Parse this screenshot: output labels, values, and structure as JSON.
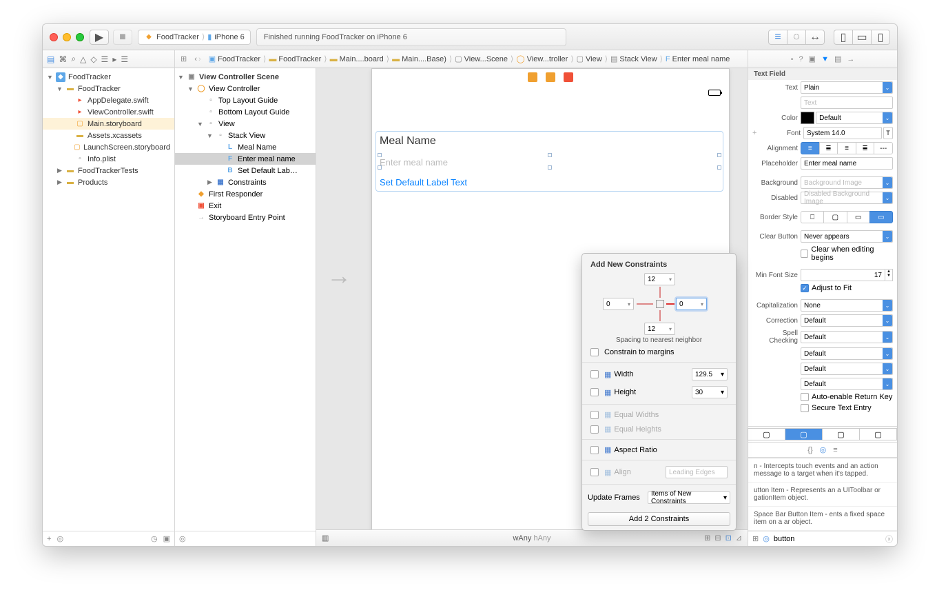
{
  "titlebar": {
    "scheme": "FoodTracker",
    "target": "iPhone 6",
    "status": "Finished running FoodTracker on iPhone 6"
  },
  "jumpbar": [
    "FoodTracker",
    "FoodTracker",
    "Main....board",
    "Main....Base)",
    "View...Scene",
    "View...troller",
    "View",
    "Stack View",
    "Enter meal name"
  ],
  "navigator": {
    "project": "FoodTracker",
    "items": [
      {
        "label": "FoodTracker",
        "depth": 1,
        "disc": "▼",
        "ico": "folder"
      },
      {
        "label": "AppDelegate.swift",
        "depth": 2,
        "ico": "swift"
      },
      {
        "label": "ViewController.swift",
        "depth": 2,
        "ico": "swift"
      },
      {
        "label": "Main.storyboard",
        "depth": 2,
        "ico": "sb",
        "sel": true
      },
      {
        "label": "Assets.xcassets",
        "depth": 2,
        "ico": "folder"
      },
      {
        "label": "LaunchScreen.storyboard",
        "depth": 2,
        "ico": "sb"
      },
      {
        "label": "Info.plist",
        "depth": 2,
        "ico": "plist"
      },
      {
        "label": "FoodTrackerTests",
        "depth": 1,
        "disc": "▶",
        "ico": "folder"
      },
      {
        "label": "Products",
        "depth": 1,
        "disc": "▶",
        "ico": "folder"
      }
    ]
  },
  "outline": {
    "header": "View Controller Scene",
    "items": [
      {
        "label": "View Controller",
        "depth": 1,
        "disc": "▼",
        "ico": "vc"
      },
      {
        "label": "Top Layout Guide",
        "depth": 2
      },
      {
        "label": "Bottom Layout Guide",
        "depth": 2
      },
      {
        "label": "View",
        "depth": 2,
        "disc": "▼"
      },
      {
        "label": "Stack View",
        "depth": 3,
        "disc": "▼"
      },
      {
        "label": "Meal Name",
        "depth": 4,
        "pref": "L"
      },
      {
        "label": "Enter meal name",
        "depth": 4,
        "sel": true,
        "pref": "F"
      },
      {
        "label": "Set Default Lab…",
        "depth": 4,
        "pref": "B"
      },
      {
        "label": "Constraints",
        "depth": 3,
        "disc": "▶",
        "ico": "con"
      },
      {
        "label": "First Responder",
        "depth": 1,
        "ico": "fr"
      },
      {
        "label": "Exit",
        "depth": 1,
        "ico": "ex"
      },
      {
        "label": "Storyboard Entry Point",
        "depth": 1,
        "ico": "ep"
      }
    ]
  },
  "canvas": {
    "mealLabel": "Meal Name",
    "placeholder": "Enter meal name",
    "button": "Set Default Label Text",
    "sizeclass_w": "wAny",
    "sizeclass_h": "hAny"
  },
  "inspector": {
    "header": "Text Field",
    "text_label": "Text",
    "text_value": "Plain",
    "text_content": "Text",
    "color_label": "Color",
    "color_value": "Default",
    "font_label": "Font",
    "font_value": "System 14.0",
    "alignment_label": "Alignment",
    "placeholder_label": "Placeholder",
    "placeholder_value": "Enter meal name",
    "background_label": "Background",
    "background_value": "Background Image",
    "disabled_label": "Disabled",
    "disabled_value": "Disabled Background Image",
    "border_label": "Border Style",
    "clear_label": "Clear Button",
    "clear_value": "Never appears",
    "clear_editing": "Clear when editing begins",
    "minfont_label": "Min Font Size",
    "minfont_value": "17",
    "adjust": "Adjust to Fit",
    "cap_label": "Capitalization",
    "cap_value": "None",
    "corr_label": "Correction",
    "corr_value": "Default",
    "spell_label": "Spell Checking",
    "spell_value": "Default",
    "kb1": "Default",
    "kb2": "Default",
    "kb3": "Default",
    "auto_return": "Auto-enable Return Key",
    "secure": "Secure Text Entry",
    "lib_search": "button",
    "lib": [
      "n - Intercepts touch events and an action message to a target when it's tapped.",
      "utton Item - Represents an a UIToolbar or gationItem object.",
      "Space Bar Button Item - ents a fixed space item on a ar object."
    ]
  },
  "popover": {
    "title": "Add New Constraints",
    "top": "12",
    "left": "0",
    "right": "0",
    "bottom": "12",
    "spacing": "Spacing to nearest neighbor",
    "margins": "Constrain to margins",
    "width_label": "Width",
    "width_value": "129.5",
    "height_label": "Height",
    "height_value": "30",
    "eq_widths": "Equal Widths",
    "eq_heights": "Equal Heights",
    "aspect": "Aspect Ratio",
    "align": "Align",
    "align_value": "Leading Edges",
    "update_label": "Update Frames",
    "update_value": "Items of New Constraints",
    "button": "Add 2 Constraints"
  }
}
